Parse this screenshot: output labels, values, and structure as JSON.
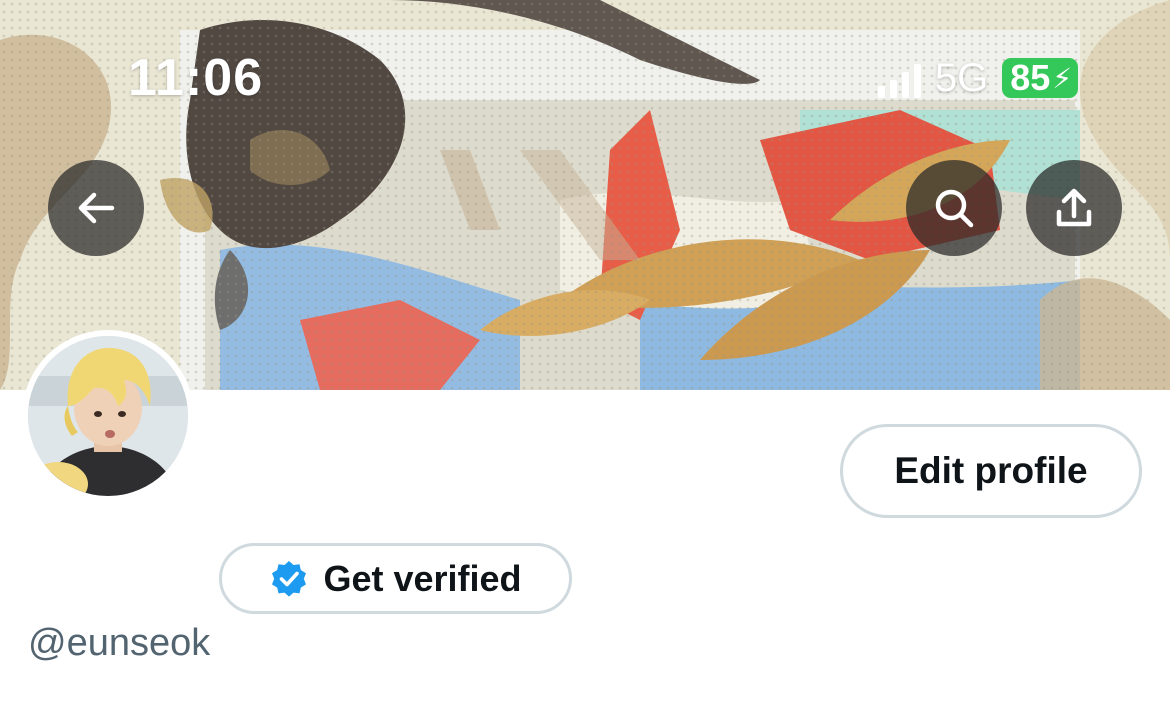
{
  "status_bar": {
    "time": "11:06",
    "network": "5G",
    "battery": "85"
  },
  "header": {
    "back_icon": "arrow-left-icon",
    "search_icon": "search-icon",
    "share_icon": "share-upload-icon"
  },
  "profile": {
    "edit_button_label": "Edit profile",
    "get_verified_label": "Get verified",
    "verified_badge_icon": "verified-badge-icon",
    "handle": "@eunseok"
  },
  "colors": {
    "battery_green": "#34c759",
    "verified_blue": "#1d9bf0",
    "border_gray": "#cfd9de",
    "text_primary": "#0f1419",
    "text_secondary": "#536471"
  }
}
